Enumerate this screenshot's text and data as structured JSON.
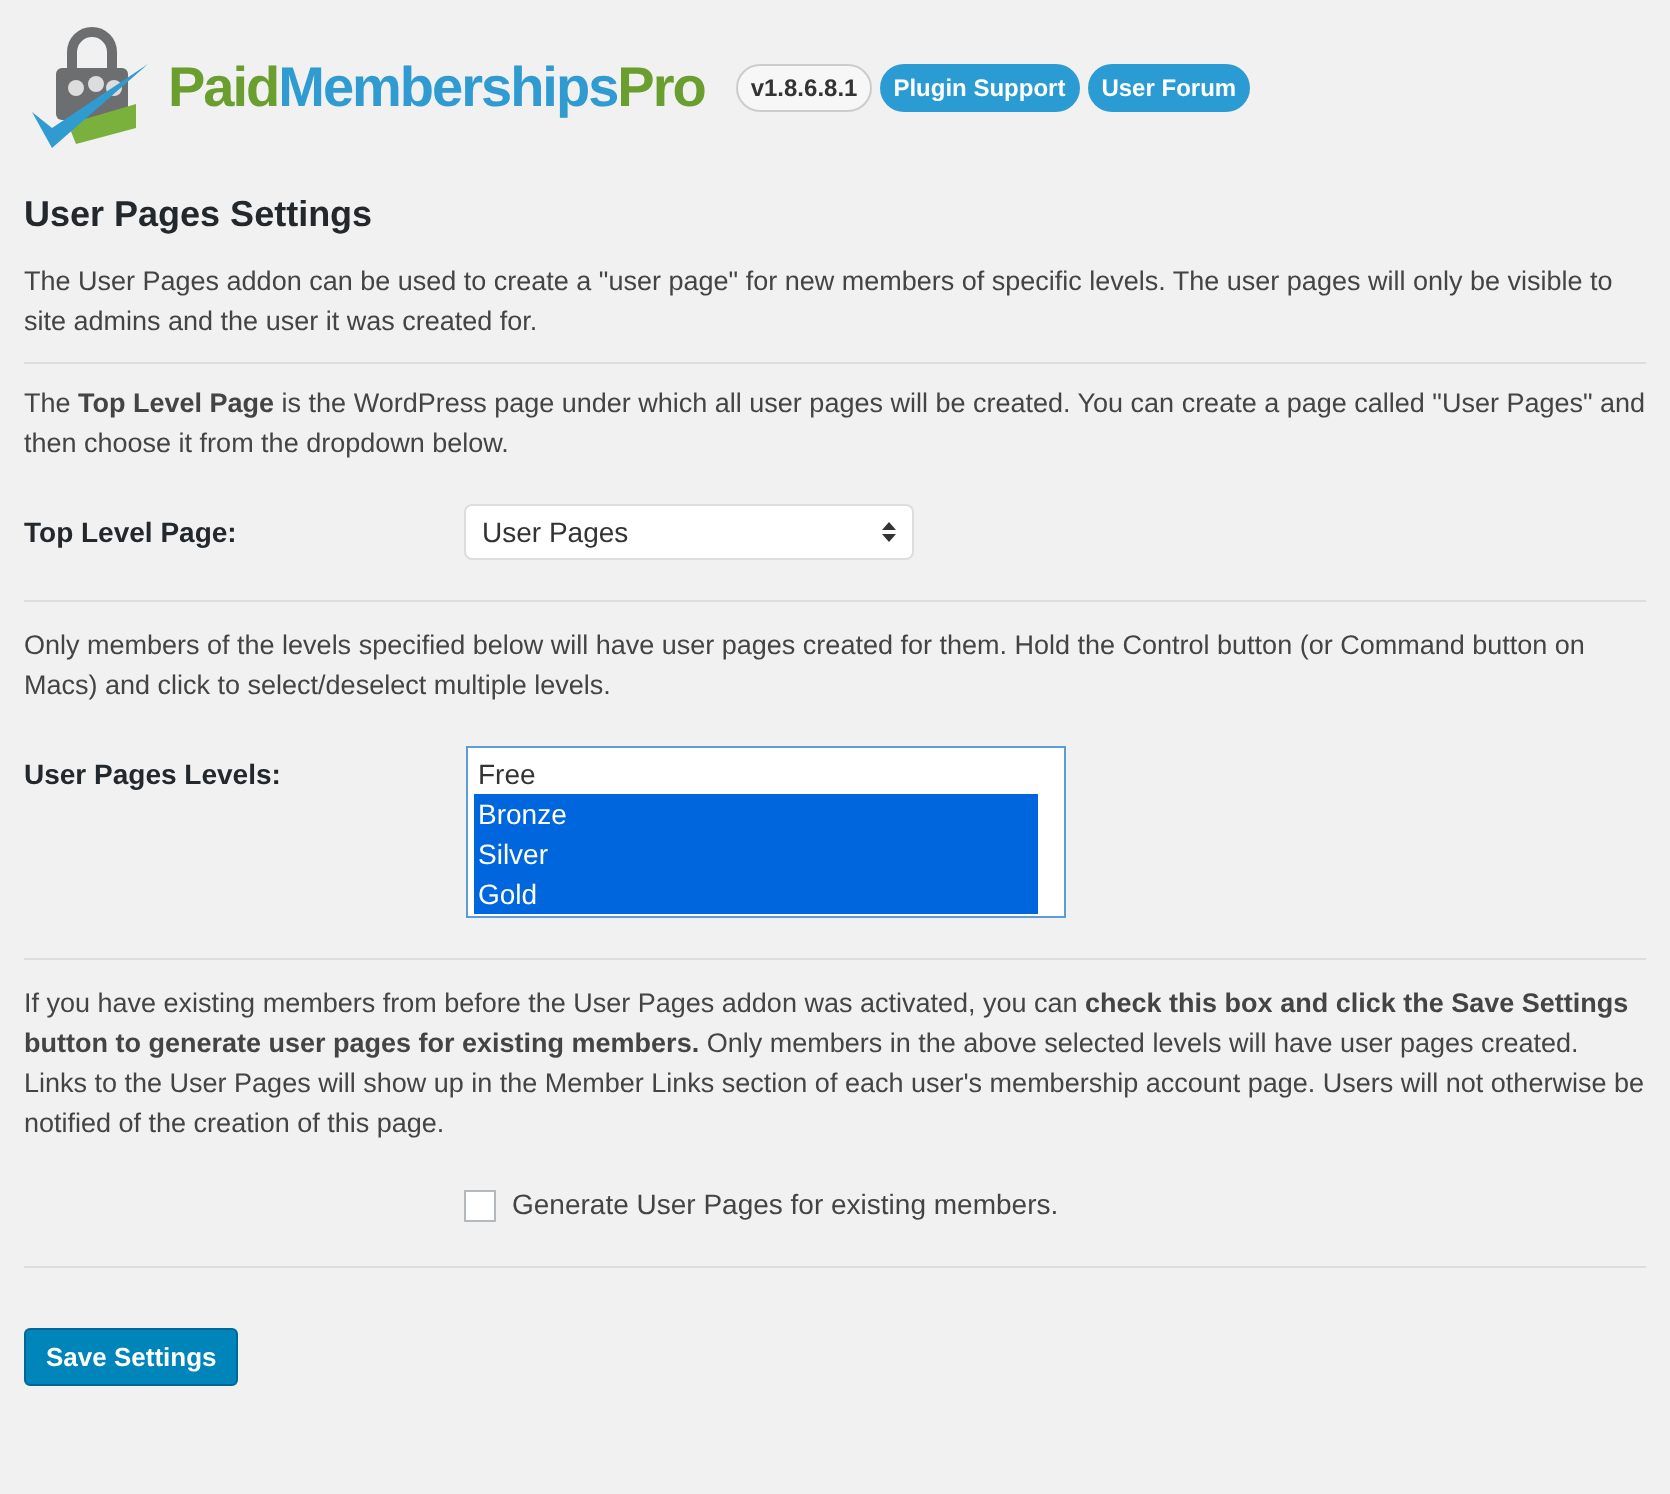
{
  "header": {
    "logo": [
      {
        "text": "Paid",
        "color": "#6a9e2f"
      },
      {
        "text": "Memberships",
        "color": "#2f9bd1"
      },
      {
        "text": "Pro",
        "color": "#6a9e2f"
      }
    ],
    "version": "v1.8.6.8.1",
    "links": [
      "Plugin Support",
      "User Forum"
    ]
  },
  "title": "User Pages Settings",
  "intro": "The User Pages addon can be used to create a \"user page\" for new members of specific levels. The user pages will only be visible to site admins and the user it was created for.",
  "top_level_note": "The **Top Level Page** is the WordPress page under which all user pages will be created. You can create a page called \"User Pages\" and then choose it from the dropdown below.",
  "top_level_field": {
    "label": "Top Level Page:",
    "value": "User Pages"
  },
  "levels_note": "Only members of the levels specified below will have user pages created for them. Hold the Control button (or Command button on Macs) and click to select/deselect multiple levels.",
  "levels_field": {
    "label": "User Pages Levels:",
    "options": [
      {
        "label": "Free",
        "selected": false
      },
      {
        "label": "Bronze",
        "selected": true
      },
      {
        "label": "Silver",
        "selected": true
      },
      {
        "label": "Gold",
        "selected": true
      }
    ]
  },
  "existing_note": "If you have existing members from before the User Pages addon was activated, you can **check this box and click the Save Settings button to generate user pages for existing members.** Only members in the above selected levels will have user pages created. Links to the User Pages will show up in the Member Links section of each user's membership account page. Users will not otherwise be notified of the creation of this page.",
  "generate_checkbox": {
    "label": "Generate User Pages for existing members.",
    "checked": false
  },
  "save_button": "Save Settings"
}
